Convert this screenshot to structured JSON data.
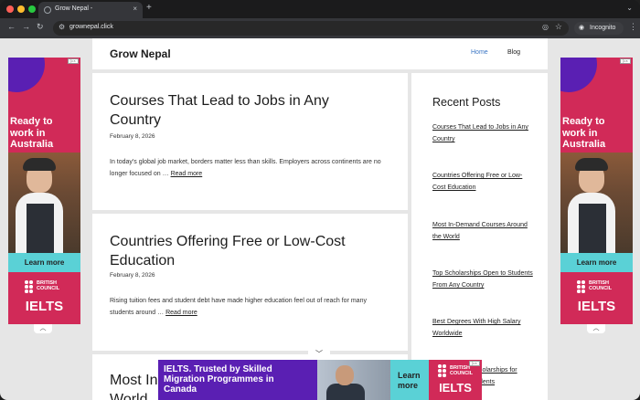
{
  "browser": {
    "tab_title": "Grow Nepal -",
    "tab_close": "×",
    "new_tab": "+",
    "tab_menu": "⌄",
    "back": "←",
    "forward": "→",
    "reload": "↻",
    "url": "grownepal.click",
    "incognito_label": "Incognito",
    "menu": "⋮"
  },
  "site": {
    "title": "Grow Nepal",
    "nav": {
      "home": "Home",
      "blog": "Blog"
    }
  },
  "posts": [
    {
      "title": "Courses That Lead to Jobs in Any Country",
      "date": "February 8, 2026",
      "excerpt": "In today's global job market, borders matter less than skills. Employers across continents are no longer focused on …",
      "read_more": "Read more"
    },
    {
      "title": "Countries Offering Free or Low-Cost Education",
      "date": "February 8, 2026",
      "excerpt": "Rising tuition fees and student debt have made higher education feel out of reach for many students around …",
      "read_more": "Read more"
    },
    {
      "title": "Most In-Demand Courses Around the World"
    }
  ],
  "sidebar": {
    "title": "Recent Posts",
    "links": [
      "Courses That Lead to Jobs in Any Country",
      "Countries Offering Free or Low-Cost Education",
      "Most In-Demand Courses Around the World",
      "Top Scholarships Open to Students From Any Country",
      "Best Degrees With High Salary Worldwide",
      "Fully Funded Scholarships for International Students"
    ]
  },
  "ads": {
    "side_headline": "Ready to work in Australia",
    "learn_more": "Learn more",
    "brand_line1": "BRITISH",
    "brand_line2": "COUNCIL",
    "brand_product": "IELTS",
    "ad_tag": "▷×",
    "collapse_up": "︿",
    "collapse_down": "﹀",
    "bottom_headline": "IELTS. Trusted by Skilled Migration Programmes in Canada",
    "colors": {
      "ad_red": "#d12a58",
      "ad_purple": "#5a1fb3",
      "ad_teal": "#5ad1d6"
    }
  },
  "colors": {
    "link_blue": "#3a75c4",
    "page_bg": "#e6e6e6"
  }
}
